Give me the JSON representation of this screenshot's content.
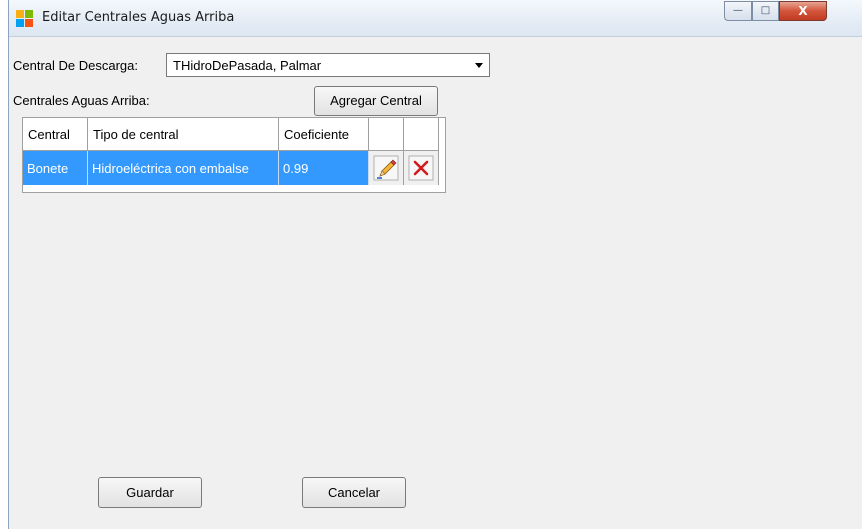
{
  "window": {
    "title": "Editar Centrales Aguas Arriba",
    "minimize_glyph": "—",
    "maximize_glyph": "□",
    "close_glyph": "X"
  },
  "form": {
    "descarga_label": "Central De Descarga:",
    "descarga_value": "THidroDePasada, Palmar",
    "aguas_arriba_label": "Centrales Aguas Arriba:",
    "agregar_button": "Agregar Central"
  },
  "grid": {
    "columns": [
      "Central",
      "Tipo de central",
      "Coeficiente",
      "",
      ""
    ],
    "rows": [
      {
        "central": "Bonete",
        "tipo": "Hidroeléctrica con embalse",
        "coeficiente": "0.99",
        "edit_icon": "pencil-icon",
        "delete_icon": "delete-x-icon"
      }
    ],
    "selected_row_color": "#3399ff"
  },
  "footer": {
    "guardar_button": "Guardar",
    "cancelar_button": "Cancelar"
  },
  "colors": {
    "close_button": "#c23b22",
    "delete_icon": "#d11a1a",
    "app_icon": [
      "#f9b016",
      "#7cbb00",
      "#00a1f1",
      "#f65314"
    ]
  }
}
